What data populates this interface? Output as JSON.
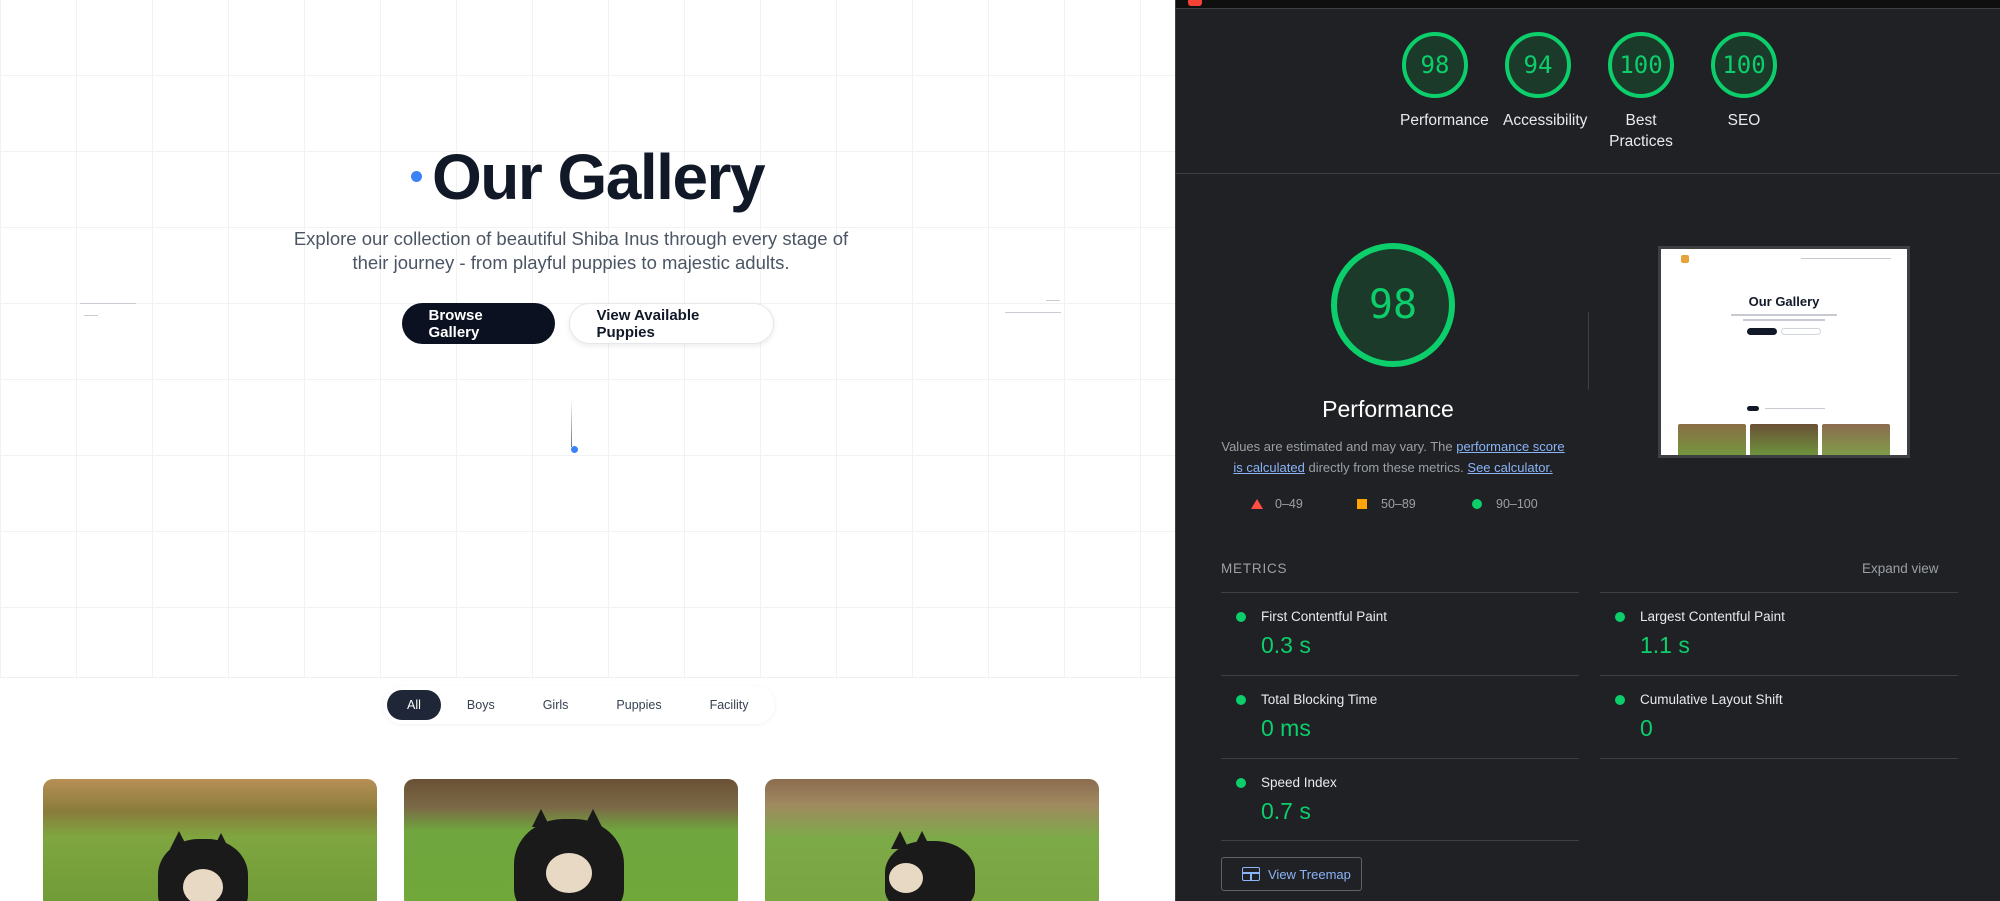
{
  "site": {
    "title": "Our Gallery",
    "subtitle": "Explore our collection of beautiful Shiba Inus through every stage of their journey - from playful puppies to majestic adults.",
    "buttons": {
      "browse": "Browse Gallery",
      "view_puppies": "View Available Puppies"
    },
    "filters": [
      "All",
      "Boys",
      "Girls",
      "Puppies",
      "Facility"
    ],
    "active_filter": "All",
    "gallery": [
      {
        "name": "photo-1",
        "subject": "shiba-dog"
      },
      {
        "name": "photo-2",
        "subject": "shiba-dog"
      },
      {
        "name": "photo-3",
        "subject": "shiba-dog"
      }
    ]
  },
  "lighthouse": {
    "categories": [
      {
        "label": "Performance",
        "score": "98"
      },
      {
        "label": "Accessibility",
        "score": "94"
      },
      {
        "label": "Best Practices",
        "score": "100"
      },
      {
        "label": "SEO",
        "score": "100"
      }
    ],
    "main": {
      "score": "98",
      "title": "Performance",
      "note_pre": "Values are estimated and may vary. The ",
      "note_link1": "performance score is calculated",
      "note_mid": " directly from these metrics. ",
      "note_link2": "See calculator."
    },
    "legend": [
      {
        "shape": "triangle",
        "range": "0–49",
        "color": "#ff4e42"
      },
      {
        "shape": "square",
        "range": "50–89",
        "color": "#ffa400"
      },
      {
        "shape": "circle",
        "range": "90–100",
        "color": "#0cce6b"
      }
    ],
    "thumbnail": {
      "title": "Our Gallery"
    },
    "metrics_heading": "METRICS",
    "expand_label": "Expand view",
    "metrics": [
      {
        "name": "First Contentful Paint",
        "value": "0.3 s"
      },
      {
        "name": "Largest Contentful Paint",
        "value": "1.1 s"
      },
      {
        "name": "Total Blocking Time",
        "value": "0 ms"
      },
      {
        "name": "Cumulative Layout Shift",
        "value": "0"
      },
      {
        "name": "Speed Index",
        "value": "0.7 s"
      }
    ],
    "treemap_label": "View Treemap",
    "colors": {
      "pass": "#0cce6b",
      "link": "#8ab4f8",
      "bg": "#202124"
    }
  }
}
